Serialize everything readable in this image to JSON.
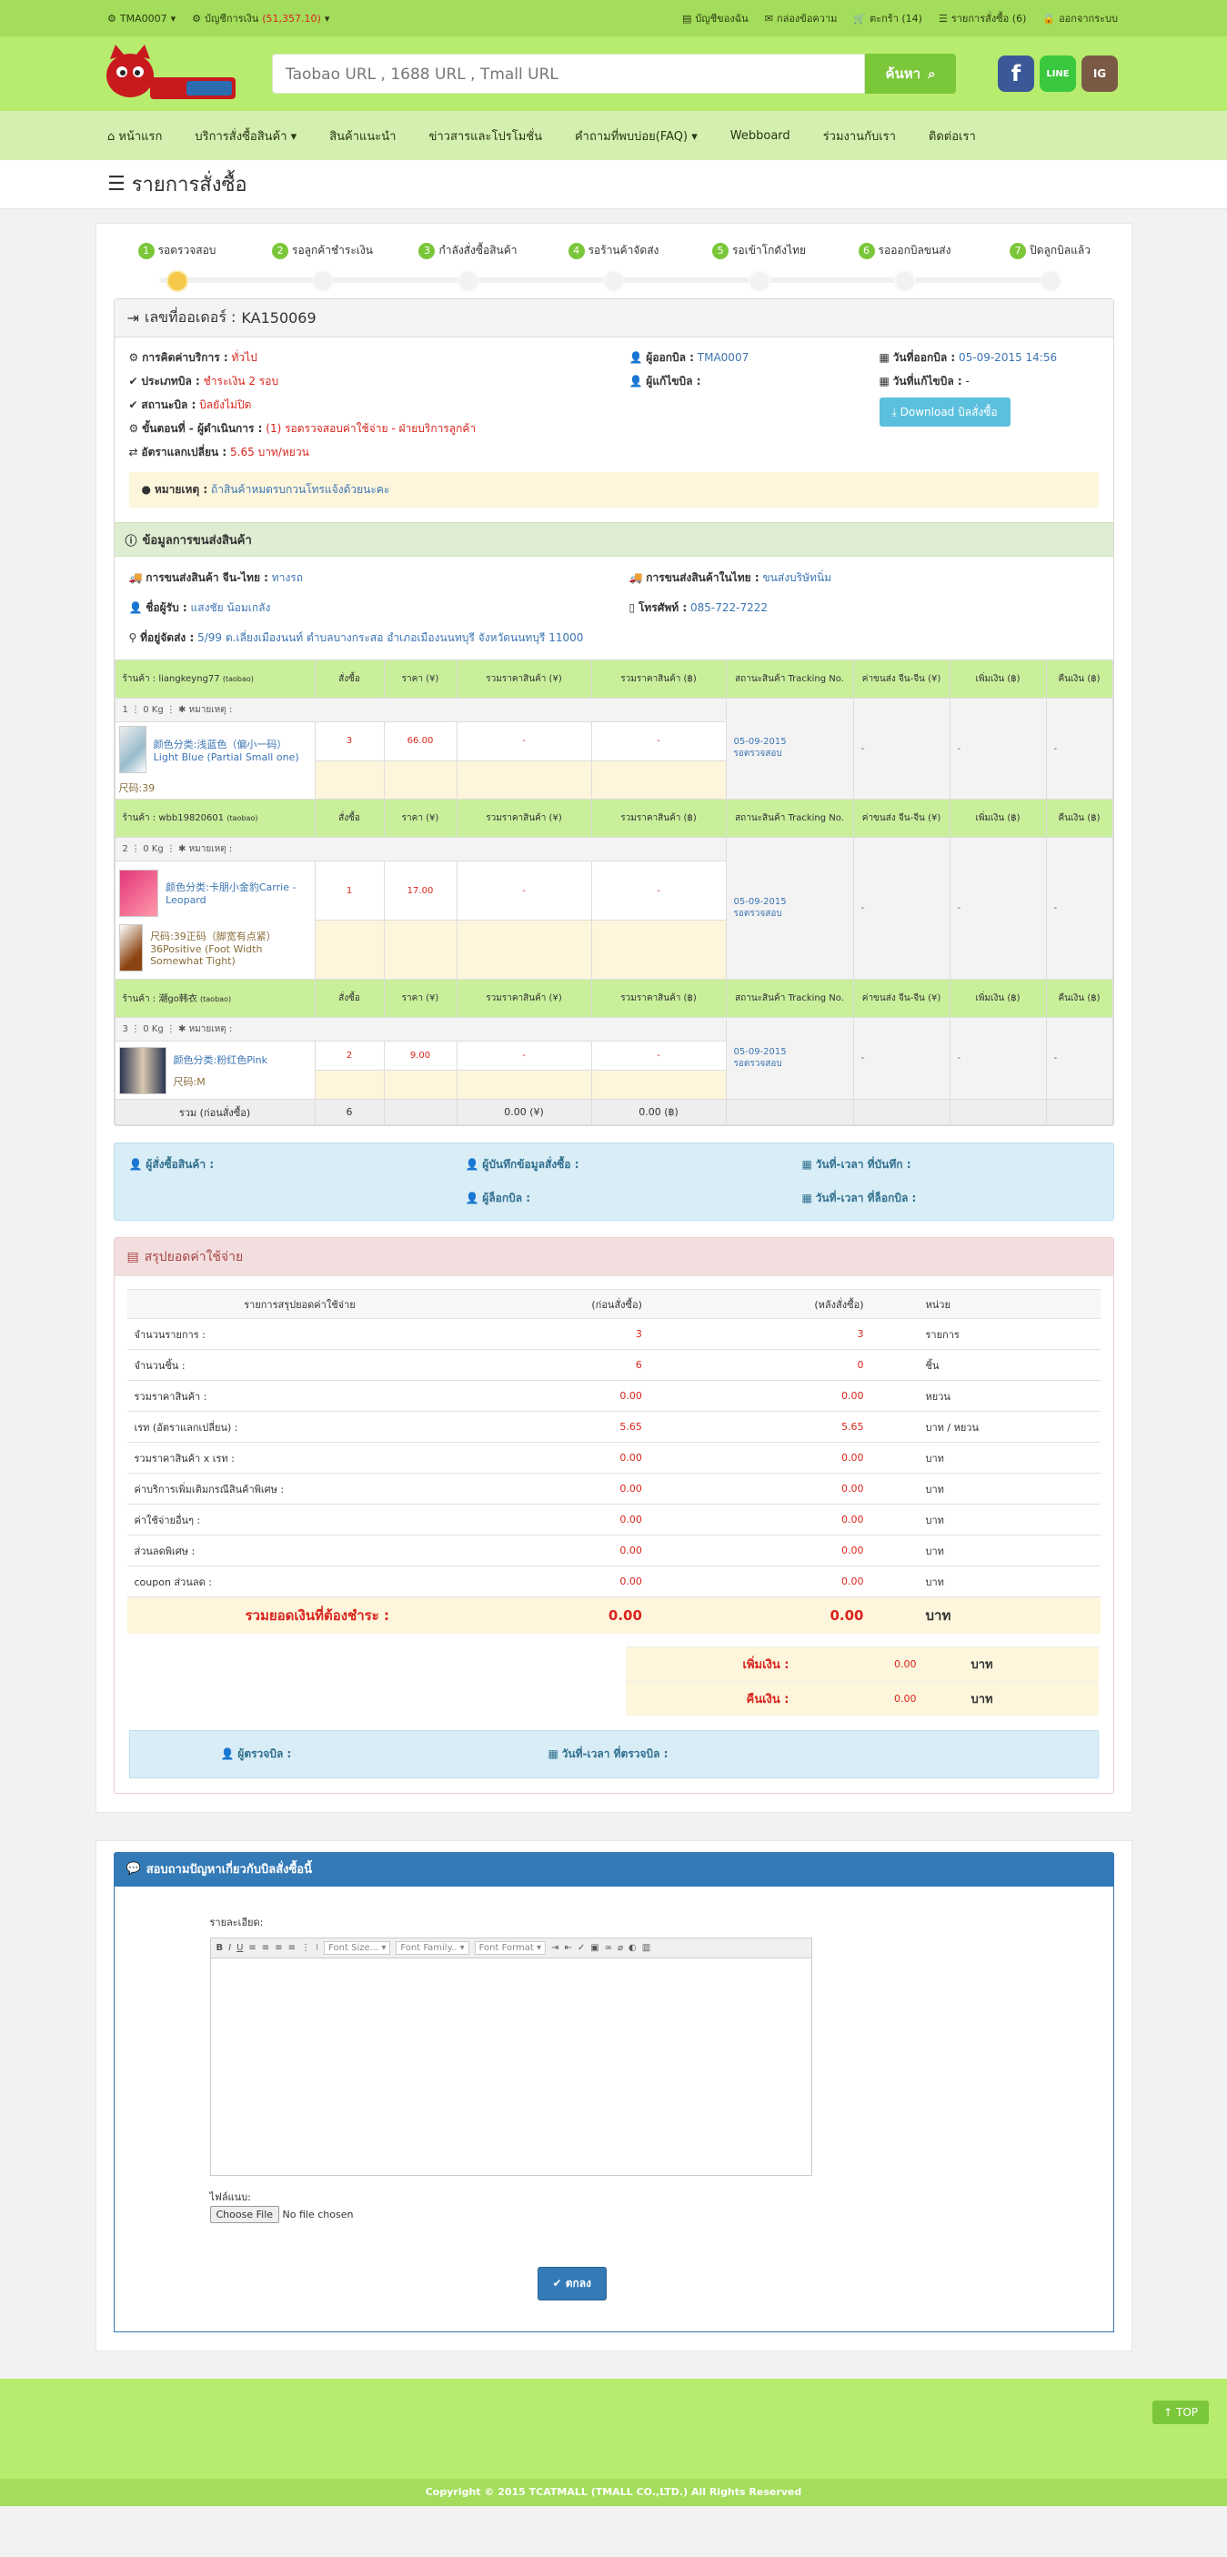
{
  "topbar": {
    "user": "TMA0007",
    "balance_label": "บัญชีการเงิน",
    "balance_value": "(51,357.10)",
    "links": [
      "บัญชีของฉัน",
      "กล่องข้อความ",
      "ตะกร้า (14)",
      "รายการสั่งซื้อ (6)",
      "ออกจากระบบ"
    ]
  },
  "search": {
    "placeholder": "Taobao URL , 1688 URL , Tmall URL",
    "button": "ค้นหา"
  },
  "social": [
    "f",
    "LINE",
    "IG"
  ],
  "nav": [
    "หน้าแรก",
    "บริการสั่งซื้อสินค้า",
    "สินค้าแนะนำ",
    "ข่าวสารและโปรโมชั่น",
    "คำถามที่พบบ่อย(FAQ)",
    "Webboard",
    "ร่วมงานกับเรา",
    "ติดต่อเรา"
  ],
  "page_title": "รายการสั่งซื้อ",
  "steps": [
    {
      "n": "1",
      "label": "รอตรวจสอบ"
    },
    {
      "n": "2",
      "label": "รอลูกค้าชำระเงิน"
    },
    {
      "n": "3",
      "label": "กำลังสั่งซื้อสินค้า"
    },
    {
      "n": "4",
      "label": "รอร้านค้าจัดส่ง"
    },
    {
      "n": "5",
      "label": "รอเข้าโกดังไทย"
    },
    {
      "n": "6",
      "label": "รอออกบิลขนส่ง"
    },
    {
      "n": "7",
      "label": "ปิดลูกบิลแล้ว"
    }
  ],
  "order": {
    "number_label": "เลขที่ออเดอร์ :",
    "number": "KA150069",
    "service_label": "การคิดค่าบริการ :",
    "service": "ทั่วไป",
    "bill_type_label": "ประเภทบิล :",
    "bill_type": "ชำระเงิน 2 รอบ",
    "status_label": "สถานะบิล :",
    "status": "บิลยังไม่ปิด",
    "stage_label": "ขั้นตอนที่ - ผู้ดำเนินการ :",
    "stage": "(1) รอตรวจสอบค่าใช้จ่าย",
    "stage_by": "- ฝ่ายบริการลูกค้า",
    "rate_label": "อัตราแลกเปลี่ยน :",
    "rate": "5.65 บาท/หยวน",
    "issuer_label": "ผู้ออกบิล :",
    "issuer": "TMA0007",
    "editor_label": "ผู้แก้ไขบิล :",
    "issued_label": "วันที่ออกบิล :",
    "issued": "05-09-2015 14:56",
    "edited_label": "วันที่แก้ไขบิล :",
    "edited": "-",
    "download": "Download บิลสั่งซื้อ",
    "note_label": "หมายเหตุ :",
    "note": "ถ้าสินค้าหมดรบกวนโทรแจ้งด้วยนะคะ"
  },
  "shipping": {
    "title": "ข้อมูลการขนส่งสินค้า",
    "cn_th_label": "การขนส่งสินค้า จีน-ไทย :",
    "cn_th": "ทางรถ",
    "th_label": "การขนส่งสินค้าในไทย :",
    "th": "ขนส่งบริษัทนิ่ม",
    "receiver_label": "ชื่อผู้รับ :",
    "receiver": "แสงชัย น้อมเกลัง",
    "phone_label": "โทรศัพท์ :",
    "phone": "085-722-7222",
    "address_label": "ที่อยู่จัดส่ง :",
    "address": "5/99 ต.เลี่ยงเมืองนนท์   ตำบลบางกระสอ   อำเภอเมืองนนทบุรี   จังหวัดนนทบุรี   11000"
  },
  "table_headers": [
    "สั่งซื้อ",
    "ราคา (¥)",
    "รวมราคาสินค้า (¥)",
    "รวมราคาสินค้า (฿)",
    "สถานะสินค้า Tracking No.",
    "ค่าขนส่ง จีน-จีน (¥)",
    "เพิ่มเงิน (฿)",
    "คืนเงิน (฿)"
  ],
  "shops": [
    {
      "name": "ร้านค้า : liangkeyng77",
      "src": "(taobao)",
      "sub": "1 ⋮ 0 Kg ⋮ ✱ หมายเหตุ :",
      "items": [
        {
          "name": "颜色分类:浅蓝色（偏小一码）Light Blue (Partial Small one)",
          "size": "尺码:39",
          "qty": "3",
          "price": "66.00",
          "sum_y": "-",
          "sum_b": "-"
        }
      ],
      "date": "05-09-2015",
      "state": "รอตรวจสอบ",
      "ship": "-",
      "add": "-",
      "refund": "-"
    },
    {
      "name": "ร้านค้า : wbb19820601",
      "src": "(taobao)",
      "sub": "2 ⋮ 0 Kg ⋮ ✱ หมายเหตุ :",
      "items": [
        {
          "name": "颜色分类:卡朋小金豹Carrie - Leopard",
          "size": "尺码:39正码（脚宽有点紧）36Positive (Foot Width Somewhat Tight)",
          "qty": "1",
          "price": "17.00",
          "sum_y": "-",
          "sum_b": "-"
        }
      ],
      "date": "05-09-2015",
      "state": "รอตรวจสอบ",
      "ship": "-",
      "add": "-",
      "refund": "-"
    },
    {
      "name": "ร้านค้า : 潮go韩衣",
      "src": "(taobao)",
      "sub": "3 ⋮ 0 Kg ⋮ ✱ หมายเหตุ :",
      "items": [
        {
          "name": "颜色分类:粉红色Pink",
          "size": "尺码:M",
          "qty": "2",
          "price": "9.00",
          "sum_y": "-",
          "sum_b": "-"
        }
      ],
      "date": "05-09-2015",
      "state": "รอตรวจสอบ",
      "ship": "-",
      "add": "-",
      "refund": "-"
    }
  ],
  "table_total": {
    "label": "รวม (ก่อนสั่งซื้อ)",
    "qty": "6",
    "sum_y": "0.00 (¥)",
    "sum_b": "0.00 (฿)"
  },
  "people": {
    "buyer": "ผู้สั่งซื้อสินค้า :",
    "recorder": "ผู้บันทึกข้อมูลสั่งซื้อ :",
    "record_date": "วันที่-เวลา ที่บันทึก :",
    "locker": "ผู้ล็อกบิล :",
    "lock_date": "วันที่-เวลา ที่ล็อกบิล :"
  },
  "summary": {
    "title": "สรุปยอดค่าใช้จ่าย",
    "headers": [
      "รายการสรุปยอดค่าใช้จ่าย",
      "(ก่อนสั่งซื้อ)",
      "(หลังสั่งซื้อ)",
      "หน่วย"
    ],
    "rows": [
      {
        "label": "จำนวนรายการ :",
        "before": "3",
        "after": "3",
        "unit": "รายการ"
      },
      {
        "label": "จำนวนชิ้น :",
        "before": "6",
        "after": "0",
        "unit": "ชิ้น"
      },
      {
        "label": "รวมราคาสินค้า :",
        "before": "0.00",
        "after": "0.00",
        "unit": "หยวน"
      },
      {
        "label": "เรท (อัตราแลกเปลี่ยน) :",
        "before": "5.65",
        "after": "5.65",
        "unit": "บาท / หยวน"
      },
      {
        "label": "รวมราคาสินค้า x เรท :",
        "before": "0.00",
        "after": "0.00",
        "unit": "บาท"
      },
      {
        "label": "ค่าบริการเพิ่มเติมกรณีสินค้าพิเศษ :",
        "before": "0.00",
        "after": "0.00",
        "unit": "บาท"
      },
      {
        "label": "ค่าใช้จ่ายอื่นๆ :",
        "before": "0.00",
        "after": "0.00",
        "unit": "บาท"
      },
      {
        "label": "ส่วนลดพิเศษ :",
        "before": "0.00",
        "after": "0.00",
        "unit": "บาท"
      },
      {
        "label": "coupon ส่วนลด :",
        "before": "0.00",
        "after": "0.00",
        "unit": "บาท"
      }
    ],
    "grand": {
      "label": "รวมยอดเงินที่ต้องชำระ :",
      "before": "0.00",
      "after": "0.00",
      "unit": "บาท"
    },
    "add_label": "เพิ่มเงิน :",
    "add_value": "0.00",
    "add_unit": "บาท",
    "refund_label": "คืนเงิน :",
    "refund_value": "0.00",
    "refund_unit": "บาท",
    "checker": "ผู้ตรวจบิล :",
    "check_date": "วันที่-เวลา ที่ตรวจบิล :"
  },
  "question": {
    "title": "สอบถามปัญหาเกี่ยวกับบิลสั่งซื้อนี้",
    "detail_label": "รายละเอียด:",
    "font_size": "Font Size...",
    "font_family": "Font Family..",
    "font_format": "Font Format",
    "file_label": "ไฟล์แนบ:",
    "choose": "Choose File",
    "nofile": "No file chosen",
    "submit": "ตกลง"
  },
  "footer": {
    "top": "TOP",
    "copyright": "Copyright © 2015 TCATMALL (TMALL CO.,LTD.) All Rights Reserved"
  },
  "colors": {
    "green": "#a3dd5b",
    "accent": "#7bc73a",
    "red": "#d9251d",
    "blue": "#337ab7"
  }
}
